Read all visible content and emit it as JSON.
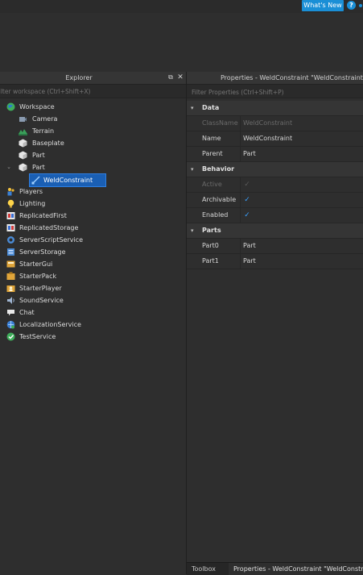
{
  "topbar": {
    "whats_new": "What's New",
    "help": "?"
  },
  "explorer": {
    "title": "Explorer",
    "filter_placeholder": "Filter workspace (Ctrl+Shift+X)",
    "items": [
      {
        "label": "Workspace",
        "icon": "workspace-globe-icon"
      },
      {
        "label": "Camera",
        "icon": "camera-icon"
      },
      {
        "label": "Terrain",
        "icon": "terrain-icon"
      },
      {
        "label": "Baseplate",
        "icon": "part-cube-icon"
      },
      {
        "label": "Part",
        "icon": "part-cube-icon"
      },
      {
        "label": "Part",
        "icon": "part-cube-icon"
      },
      {
        "label": "WeldConstraint",
        "icon": "weld-constraint-icon"
      },
      {
        "label": "Players",
        "icon": "players-icon"
      },
      {
        "label": "Lighting",
        "icon": "lighting-bulb-icon"
      },
      {
        "label": "ReplicatedFirst",
        "icon": "replicated-first-icon"
      },
      {
        "label": "ReplicatedStorage",
        "icon": "replicated-storage-icon"
      },
      {
        "label": "ServerScriptService",
        "icon": "server-script-service-icon"
      },
      {
        "label": "ServerStorage",
        "icon": "server-storage-icon"
      },
      {
        "label": "StarterGui",
        "icon": "starter-gui-icon"
      },
      {
        "label": "StarterPack",
        "icon": "starter-pack-icon"
      },
      {
        "label": "StarterPlayer",
        "icon": "starter-player-icon"
      },
      {
        "label": "SoundService",
        "icon": "sound-service-icon"
      },
      {
        "label": "Chat",
        "icon": "chat-icon"
      },
      {
        "label": "LocalizationService",
        "icon": "localization-service-icon"
      },
      {
        "label": "TestService",
        "icon": "test-service-icon"
      }
    ]
  },
  "properties": {
    "title": "Properties - WeldConstraint \"WeldConstraint\"",
    "filter_placeholder": "Filter Properties (Ctrl+Shift+P)",
    "categories": {
      "data": "Data",
      "behavior": "Behavior",
      "parts": "Parts"
    },
    "rows": {
      "classname": {
        "name": "ClassName",
        "value": "WeldConstraint"
      },
      "name": {
        "name": "Name",
        "value": "WeldConstraint"
      },
      "parent": {
        "name": "Parent",
        "value": "Part"
      },
      "active": {
        "name": "Active",
        "checked": true
      },
      "archivable": {
        "name": "Archivable",
        "checked": true
      },
      "enabled": {
        "name": "Enabled",
        "checked": true
      },
      "part0": {
        "name": "Part0",
        "value": "Part"
      },
      "part1": {
        "name": "Part1",
        "value": "Part"
      }
    }
  },
  "bottom_tabs": {
    "toolbox": "Toolbox",
    "properties": "Properties - WeldConstraint \"WeldConstraint\""
  },
  "colors": {
    "accent": "#1a8fd6",
    "selection": "#1a5fb4",
    "panel": "#2e2e2e",
    "header": "#353535"
  }
}
